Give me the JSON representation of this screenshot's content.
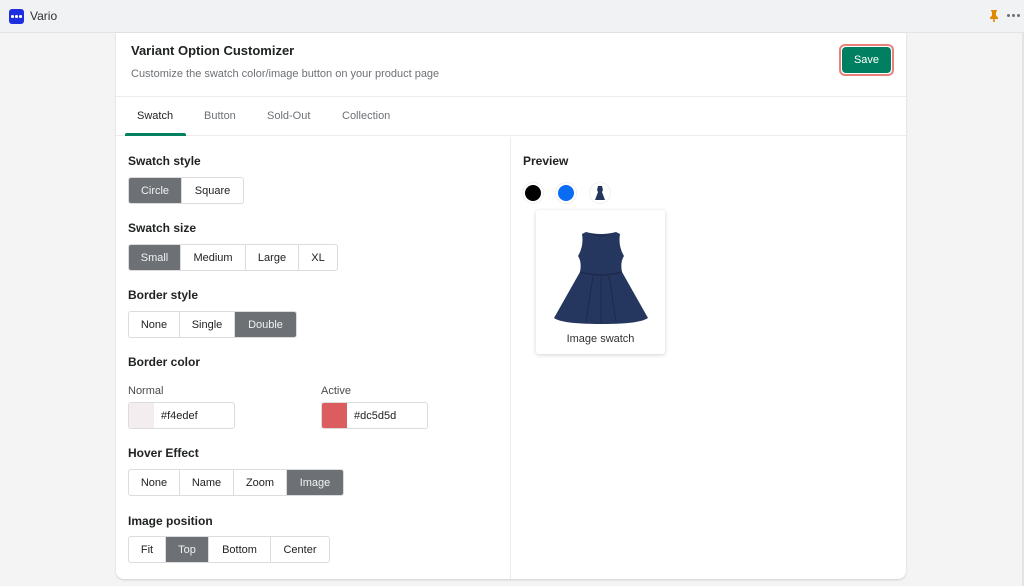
{
  "window": {
    "app_name": "Vario"
  },
  "header": {
    "title": "Variant Option Customizer",
    "subtitle": "Customize the swatch color/image button on your product page",
    "save_label": "Save"
  },
  "tabs": [
    {
      "label": "Swatch",
      "active": true
    },
    {
      "label": "Button",
      "active": false
    },
    {
      "label": "Sold-Out",
      "active": false
    },
    {
      "label": "Collection",
      "active": false
    }
  ],
  "settings": {
    "swatch_style": {
      "label": "Swatch style",
      "options": [
        "Circle",
        "Square"
      ],
      "selected": "Circle"
    },
    "swatch_size": {
      "label": "Swatch size",
      "options": [
        "Small",
        "Medium",
        "Large",
        "XL"
      ],
      "selected": "Small"
    },
    "border_style": {
      "label": "Border style",
      "options": [
        "None",
        "Single",
        "Double"
      ],
      "selected": "Double"
    },
    "border_color": {
      "label": "Border color",
      "normal": {
        "label": "Normal",
        "value": "#f4edef"
      },
      "active": {
        "label": "Active",
        "value": "#dc5d5d"
      }
    },
    "hover_effect": {
      "label": "Hover Effect",
      "options": [
        "None",
        "Name",
        "Zoom",
        "Image"
      ],
      "selected": "Image"
    },
    "image_position": {
      "label": "Image position",
      "options": [
        "Fit",
        "Top",
        "Bottom",
        "Center"
      ],
      "selected": "Top"
    }
  },
  "preview": {
    "label": "Preview",
    "swatches": [
      {
        "type": "color",
        "color": "#000000"
      },
      {
        "type": "color",
        "color": "#0a6cf5"
      },
      {
        "type": "image",
        "icon": "dress-icon"
      }
    ],
    "popup_caption": "Image swatch"
  },
  "colors": {
    "accent": "#008060",
    "selected_segment": "#6d7175",
    "save_outline": "#e9827c",
    "app_icon": "#1f2fe0",
    "pin": "#e08a00"
  }
}
